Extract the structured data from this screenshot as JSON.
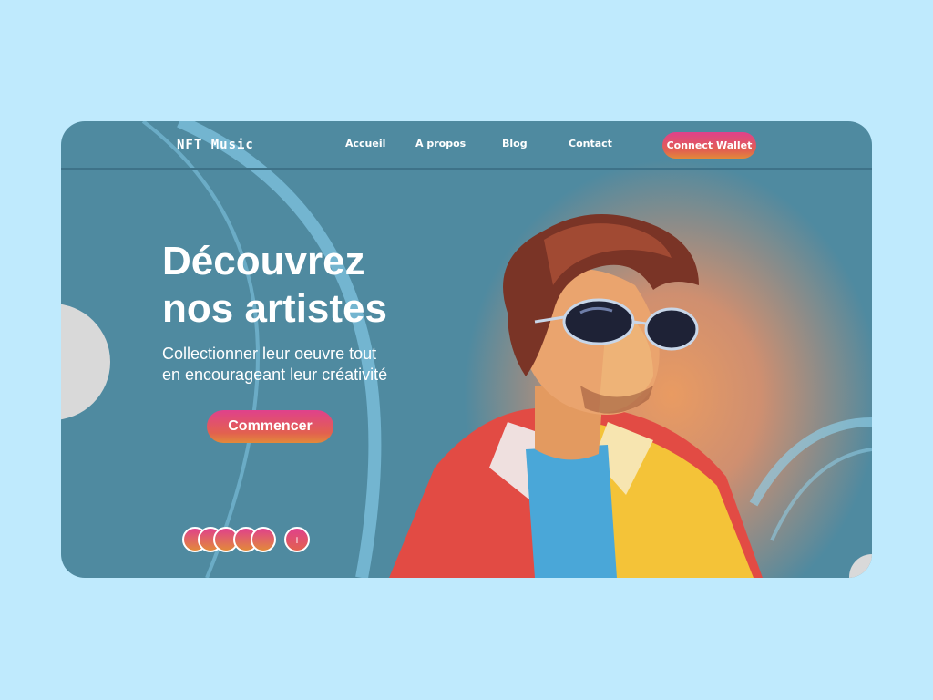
{
  "brand": {
    "logo_text": "NFT Music"
  },
  "nav": {
    "items": [
      {
        "label": "Accueil"
      },
      {
        "label": "A propos"
      },
      {
        "label": "Blog"
      },
      {
        "label": "Contact"
      }
    ],
    "connect_label": "Connect Wallet"
  },
  "hero": {
    "title_line1": "Découvrez",
    "title_line2": "nos artistes",
    "subtitle_line1": "Collectionner leur oeuvre tout",
    "subtitle_line2": "en encourageant leur créativité",
    "cta_label": "Commencer"
  },
  "collectors": {
    "add_label": "+"
  },
  "colors": {
    "page_background": "#bfeafd",
    "card_background": "#4f8aa0",
    "accent_gradient_start": "#e0418b",
    "accent_gradient_end": "#e28a3a",
    "arc_color": "#7fc3e0"
  },
  "icons": {
    "side_circle_left": "decorative-circle",
    "side_circle_right": "decorative-circle"
  }
}
